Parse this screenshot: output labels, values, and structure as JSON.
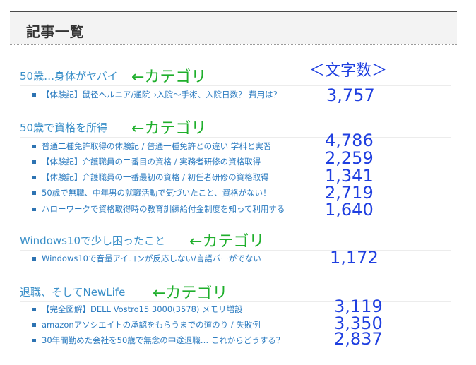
{
  "page_title": "記事一覧",
  "count_header": "＜文字数＞",
  "annotation_text": "←カテゴリ",
  "colors": {
    "category_link": "#3a8fc8",
    "article_link": "#2b7bc0",
    "annotation": "#1faf2c",
    "count": "#1f3fe0"
  },
  "categories": [
    {
      "name": "50歳…身体がヤバイ",
      "articles": [
        {
          "title": "【体験記】鼠径ヘルニア/通院→入院～手術、入院日数？ 費用は？",
          "count": "3,757"
        }
      ]
    },
    {
      "name": "50歳で資格を所得",
      "articles": [
        {
          "title": "普通二種免許取得の体験記 / 普通一種免許との違い 学科と実習",
          "count": "4,786"
        },
        {
          "title": "【体験記】介護職員の二番目の資格 / 実務者研修の資格取得",
          "count": "2,259"
        },
        {
          "title": "【体験記】介護職員の一番最初の資格 / 初任者研修の資格取得",
          "count": "1,341"
        },
        {
          "title": "50歳で無職、中年男の就職活動で気づいたこと、資格がない！",
          "count": "2,719"
        },
        {
          "title": "ハローワークで資格取得時の教育訓練給付金制度を知って利用する",
          "count": "1,640"
        }
      ]
    },
    {
      "name": "Windows10で少し困ったこと",
      "articles": [
        {
          "title": "Windows10で音量アイコンが反応しない/言語バーがでない",
          "count": "1,172"
        }
      ]
    },
    {
      "name": "退職、そしてNewLife",
      "articles": [
        {
          "title": "【完全図解】DELL Vostro15 3000(3578) メモリ増設",
          "count": "3,119"
        },
        {
          "title": "amazonアソシエイトの承認をもらうまでの道のり / 失敗例",
          "count": "3,350"
        },
        {
          "title": "30年間勤めた会社を50歳で無念の中途退職… これからどうする？",
          "count": "2,837"
        }
      ]
    }
  ]
}
